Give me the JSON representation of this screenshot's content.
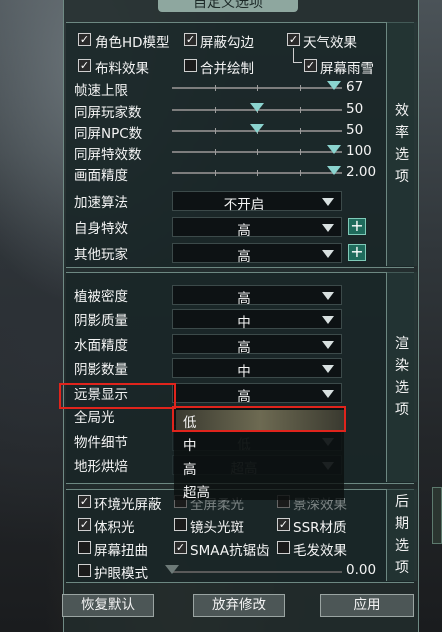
{
  "title": "自定义选项",
  "efficiency": {
    "tab_chars": [
      "效",
      "率",
      "选",
      "项"
    ],
    "checkboxes": [
      {
        "label": "角色HD模型",
        "checked": true
      },
      {
        "label": "屏蔽勾边",
        "checked": true
      },
      {
        "label": "天气效果",
        "checked": true
      },
      {
        "label": "布料效果",
        "checked": true
      },
      {
        "label": "合并绘制",
        "checked": false
      },
      {
        "label": "屏幕雨雪",
        "checked": true
      }
    ],
    "sliders": [
      {
        "label": "帧速上限",
        "value": "67",
        "level": 0.95
      },
      {
        "label": "同屏玩家数",
        "value": "50",
        "level": 0.5
      },
      {
        "label": "同屏NPC数",
        "value": "50",
        "level": 0.5
      },
      {
        "label": "同屏特效数",
        "value": "100",
        "level": 0.95
      },
      {
        "label": "画面精度",
        "value": "2.00",
        "level": 0.95
      }
    ],
    "dropdowns": [
      {
        "label": "加速算法",
        "value": "不开启"
      },
      {
        "label": "自身特效",
        "value": "高"
      },
      {
        "label": "其他玩家",
        "value": "高"
      }
    ],
    "plus": "+"
  },
  "render": {
    "tab_chars": [
      "渲",
      "染",
      "选",
      "项"
    ],
    "dropdowns": [
      {
        "label": "植被密度",
        "value": "高"
      },
      {
        "label": "阴影质量",
        "value": "中"
      },
      {
        "label": "水面精度",
        "value": "高"
      },
      {
        "label": "阴影数量",
        "value": "中"
      },
      {
        "label": "远景显示",
        "value": "高"
      },
      {
        "label": "全局光",
        "value": "中"
      },
      {
        "label": "物件细节",
        "value": "低"
      },
      {
        "label": "地形烘焙",
        "value": "超高"
      }
    ],
    "open_menu": [
      "低",
      "中",
      "高",
      "超高"
    ]
  },
  "post": {
    "tab_chars": [
      "后",
      "期",
      "选",
      "项"
    ],
    "checkboxes": [
      {
        "label": "环境光屏蔽",
        "checked": true
      },
      {
        "label": "全屏柔光",
        "checked": false
      },
      {
        "label": "景深效果",
        "checked": false
      },
      {
        "label": "体积光",
        "checked": true
      },
      {
        "label": "镜头光斑",
        "checked": false
      },
      {
        "label": "SSR材质",
        "checked": true
      },
      {
        "label": "屏幕扭曲",
        "checked": false
      },
      {
        "label": "SMAA抗锯齿",
        "checked": true
      },
      {
        "label": "毛发效果",
        "checked": false
      },
      {
        "label": "护眼模式",
        "checked": false
      }
    ],
    "eye_value": "0.00",
    "eye_level": 0.0
  },
  "buttons": {
    "reset": "恢复默认",
    "discard": "放弃修改",
    "apply": "应用"
  },
  "colors": {
    "accent": "#8bd4cf",
    "highlight": "#e0241c",
    "plus_bg": "#1f6b5c"
  }
}
